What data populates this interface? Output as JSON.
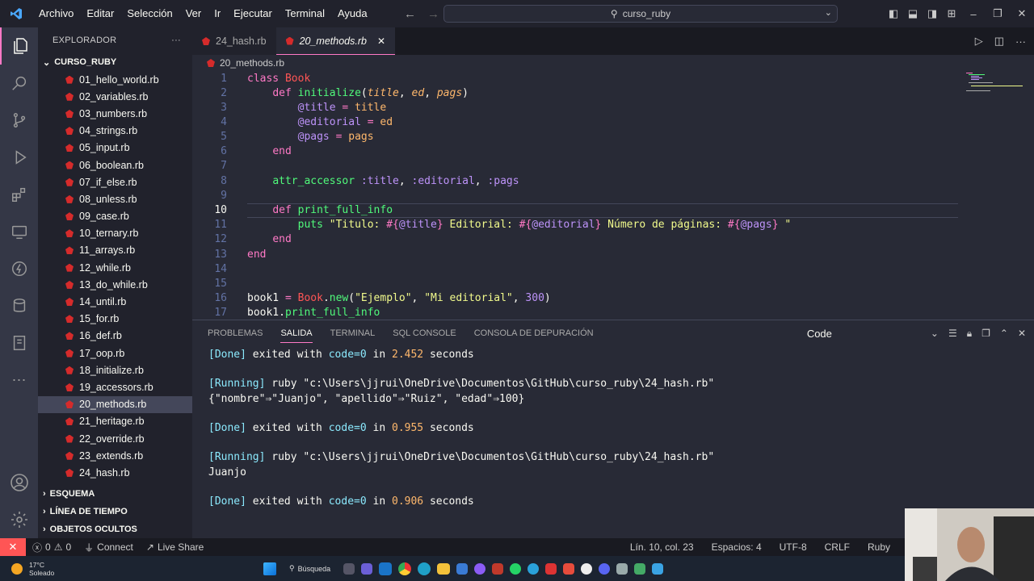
{
  "menu": [
    "Archivo",
    "Editar",
    "Selección",
    "Ver",
    "Ir",
    "Ejecutar",
    "Terminal",
    "Ayuda"
  ],
  "search": {
    "text": "curso_ruby"
  },
  "sidebar": {
    "title": "EXPLORADOR",
    "folder": "CURSO_RUBY",
    "files": [
      "01_hello_world.rb",
      "02_variables.rb",
      "03_numbers.rb",
      "04_strings.rb",
      "05_input.rb",
      "06_boolean.rb",
      "07_if_else.rb",
      "08_unless.rb",
      "09_case.rb",
      "10_ternary.rb",
      "11_arrays.rb",
      "12_while.rb",
      "13_do_while.rb",
      "14_until.rb",
      "15_for.rb",
      "16_def.rb",
      "17_oop.rb",
      "18_initialize.rb",
      "19_accessors.rb",
      "20_methods.rb",
      "21_heritage.rb",
      "22_override.rb",
      "23_extends.rb",
      "24_hash.rb"
    ],
    "selected_index": 19,
    "sections": [
      "ESQUEMA",
      "LÍNEA DE TIEMPO",
      "OBJETOS OCULTOS"
    ]
  },
  "tabs": [
    {
      "label": "24_hash.rb",
      "active": false
    },
    {
      "label": "20_methods.rb",
      "active": true
    }
  ],
  "breadcrumb": "20_methods.rb",
  "editor": {
    "line_numbers": [
      "1",
      "2",
      "3",
      "4",
      "5",
      "6",
      "7",
      "8",
      "9",
      "10",
      "11",
      "12",
      "13",
      "14",
      "15",
      "16",
      "17"
    ],
    "current_line": 10
  },
  "panel": {
    "tabs": [
      "PROBLEMAS",
      "SALIDA",
      "TERMINAL",
      "SQL CONSOLE",
      "CONSOLA DE DEPURACIÓN"
    ],
    "active_tab": "SALIDA",
    "output_channel": "Code",
    "lines": {
      "done1_tag": "[Done]",
      "done1_mid": " exited with ",
      "done1_code": "code=0",
      "done1_in": " in ",
      "done1_num": "2.452",
      "done1_sec": " seconds",
      "run1_tag": "[Running]",
      "run1_cmd": " ruby \"c:\\Users\\jjrui\\OneDrive\\Documentos\\GitHub\\curso_ruby\\24_hash.rb\"",
      "hash_out": "{\"nombre\"⇒\"Juanjo\", \"apellido\"⇒\"Ruiz\", \"edad\"⇒100}",
      "done2_tag": "[Done]",
      "done2_mid": " exited with ",
      "done2_code": "code=0",
      "done2_in": " in ",
      "done2_num": "0.955",
      "done2_sec": " seconds",
      "run2_tag": "[Running]",
      "run2_cmd": " ruby \"c:\\Users\\jjrui\\OneDrive\\Documentos\\GitHub\\curso_ruby\\24_hash.rb\"",
      "name_out": "Juanjo",
      "done3_tag": "[Done]",
      "done3_mid": " exited with ",
      "done3_code": "code=0",
      "done3_in": " in ",
      "done3_num": "0.906",
      "done3_sec": " seconds"
    }
  },
  "statusbar": {
    "errors": "0",
    "warnings": "0",
    "connect": "Connect",
    "live_share": "Live Share",
    "position": "Lín. 10, col. 23",
    "spaces": "Espacios: 4",
    "encoding": "UTF-8",
    "eol": "CRLF",
    "language": "Ruby"
  },
  "taskbar": {
    "temperature": "17°C",
    "weather": "Soleado",
    "search_label": "Búsqueda"
  },
  "colors": {
    "accent": "#ff79c6",
    "background": "#282a36",
    "sidebar": "#21222c",
    "remote": "#ff5555"
  }
}
